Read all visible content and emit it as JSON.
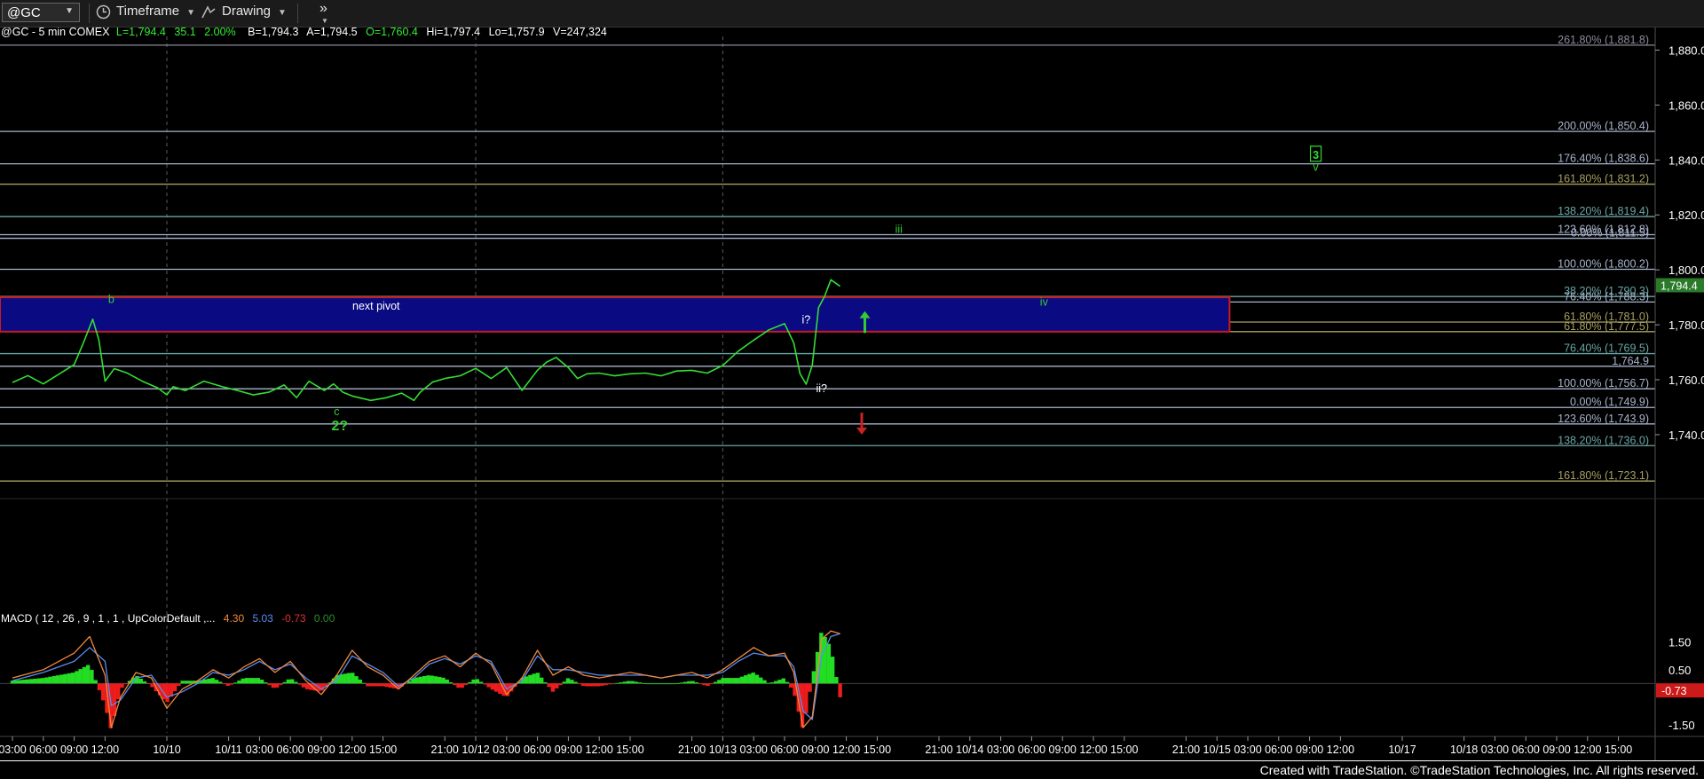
{
  "toolbar": {
    "symbol": "@GC",
    "timeframe_label": "Timeframe",
    "drawing_label": "Drawing",
    "more_label": "»"
  },
  "header": {
    "symbol_info": "@GC - 5 min  COMEX",
    "last": "L=1,794.4",
    "change": "35.1",
    "pct": "2.00%",
    "bid": "B=1,794.3",
    "ask": "A=1,794.5",
    "open": "O=1,760.4",
    "high": "Hi=1,797.4",
    "low": "Lo=1,757.9",
    "volume": "V=247,324"
  },
  "footer": {
    "text": "Created with TradeStation. ©TradeStation Technologies, Inc. All rights reserved."
  },
  "chart_data": {
    "type": "line",
    "ylim": [
      1718,
      1885
    ],
    "y_ticks": [
      1740,
      1760,
      1780,
      1800,
      1820,
      1840,
      1860,
      1880
    ],
    "y_tick_labels": [
      "1,740.0",
      "1,760.0",
      "1,780.0",
      "1,800.0",
      "1,820.0",
      "1,840.0",
      "1,860.0",
      "1,880.0"
    ],
    "current_price": {
      "value": 1794.4,
      "label": "1,794.4"
    },
    "x_labels": [
      "03:00",
      "06:00",
      "09:00",
      "12:00",
      "10/10",
      "10/11",
      "03:00",
      "06:00",
      "09:00",
      "12:00",
      "15:00",
      "21:00",
      "10/12",
      "03:00",
      "06:00",
      "09:00",
      "12:00",
      "15:00",
      "21:00",
      "10/13",
      "03:00",
      "06:00",
      "09:00",
      "12:00",
      "15:00",
      "21:00",
      "10/14",
      "03:00",
      "06:00",
      "09:00",
      "12:00",
      "15:00",
      "21:00",
      "10/15",
      "03:00",
      "06:00",
      "09:00",
      "12:00",
      "10/17",
      "10/18",
      "03:00",
      "06:00",
      "09:00",
      "12:00",
      "15:00"
    ],
    "x_label_index": [
      0,
      1,
      2,
      3,
      5,
      7,
      8,
      9,
      10,
      11,
      12,
      14,
      15,
      16,
      17,
      18,
      19,
      20,
      22,
      23,
      24,
      25,
      26,
      27,
      28,
      30,
      31,
      32,
      33,
      34,
      35,
      36,
      38,
      39,
      40,
      41,
      42,
      43,
      45,
      47,
      48,
      49,
      50,
      51,
      52
    ],
    "price_series": {
      "name": "@GC",
      "color": "#33dd33",
      "x": [
        0,
        0.5,
        1,
        1.5,
        2,
        2.3,
        2.6,
        2.8,
        3.0,
        3.3,
        3.7,
        4.2,
        4.7,
        5.0,
        5.2,
        5.6,
        6.2,
        6.8,
        7.3,
        7.8,
        8.3,
        8.8,
        9.2,
        9.6,
        10.1,
        10.4,
        10.7,
        11.0,
        11.6,
        12.1,
        12.6,
        13.0,
        13.2,
        13.6,
        14.0,
        14.5,
        15.0,
        15.5,
        16.0,
        16.5,
        17.0,
        17.3,
        17.6,
        18.0,
        18.3,
        18.6,
        19.0,
        19.5,
        20.0,
        20.5,
        21.0,
        21.5,
        22.0,
        22.5,
        23.0,
        23.5,
        24.0,
        24.5,
        25.0,
        25.3,
        25.5,
        25.7,
        25.9,
        26.1,
        26.3,
        26.5,
        26.8
      ],
      "y": [
        1759,
        1761,
        1759,
        1762,
        1765,
        1774,
        1782,
        1774,
        1760,
        1764,
        1762,
        1760,
        1757,
        1754,
        1758,
        1756,
        1759,
        1758,
        1756,
        1754,
        1756,
        1758,
        1753,
        1760,
        1756,
        1758,
        1756,
        1754,
        1752,
        1754,
        1755,
        1752,
        1756,
        1759,
        1760,
        1762,
        1764,
        1760,
        1765,
        1756,
        1763,
        1767,
        1768,
        1764,
        1761,
        1762,
        1762,
        1762,
        1762,
        1762,
        1762,
        1763,
        1763,
        1763,
        1765,
        1770,
        1775,
        1778,
        1780,
        1774,
        1762,
        1758,
        1766,
        1786,
        1790,
        1797,
        1794
      ]
    },
    "zone": {
      "label": "next pivot",
      "from": 1777.5,
      "to": 1790,
      "x_end": 38
    },
    "fib_lines": [
      {
        "value": 1881.8,
        "label": "261.80% (1,881.8)",
        "color": "#8a8a9a"
      },
      {
        "value": 1850.4,
        "label": "200.00% (1,850.4)",
        "color": "#a8b4cc"
      },
      {
        "value": 1838.6,
        "label": "176.40% (1,838.6)",
        "color": "#a8b4cc"
      },
      {
        "value": 1831.2,
        "label": "161.80% (1,831.2)",
        "color": "#a8a060"
      },
      {
        "value": 1819.4,
        "label": "138.20% (1,819.4)",
        "color": "#6aa6a6"
      },
      {
        "value": 1812.8,
        "label": "123.60% (1,812.8)",
        "color": "#a8b4cc"
      },
      {
        "value": 1811.5,
        "label": "0.00% (1,811.5)",
        "color": "#a8b4cc"
      },
      {
        "value": 1800.2,
        "label": "100.00% (1,800.2)",
        "color": "#a8b4cc"
      },
      {
        "value": 1790.3,
        "label": "38.20% (1,790.3)",
        "color": "#6aa6a6"
      },
      {
        "value": 1788.3,
        "label": "76.40% (1,788.3)",
        "color": "#a8b4cc"
      },
      {
        "value": 1781.0,
        "label": "61.80% (1,781.0)",
        "color": "#a8a060"
      },
      {
        "value": 1777.5,
        "label": "61.80% (1,777.5)",
        "color": "#a8a060"
      },
      {
        "value": 1769.5,
        "label": "76.40% (1,769.5)",
        "color": "#6aa6a6"
      },
      {
        "value": 1764.9,
        "label": "1,764.9",
        "color": "#a8b4cc"
      },
      {
        "value": 1756.7,
        "label": "100.00% (1,756.7)",
        "color": "#a8b4cc"
      },
      {
        "value": 1749.9,
        "label": "0.00% (1,749.9)",
        "color": "#a8b4cc"
      },
      {
        "value": 1743.9,
        "label": "123.60% (1,743.9)",
        "color": "#a8b4cc"
      },
      {
        "value": 1736.0,
        "label": "138.20% (1,736.0)",
        "color": "#6aa6a6"
      },
      {
        "value": 1723.1,
        "label": "161.80% (1,723.1)",
        "color": "#a8a060"
      }
    ],
    "wave_labels": [
      {
        "text": "b",
        "x": 3.2,
        "y": 1788,
        "color": "#33cc33"
      },
      {
        "text": "c",
        "x": 10.5,
        "y": 1747,
        "color": "#33cc33"
      },
      {
        "text": "2?",
        "x": 10.6,
        "y": 1741.5,
        "color": "#33cc33",
        "bold": true
      },
      {
        "text": "i?",
        "x": 25.7,
        "y": 1780.5,
        "color": "#ffffff"
      },
      {
        "text": "ii?",
        "x": 26.2,
        "y": 1755.5,
        "color": "#ffffff"
      },
      {
        "text": "iii",
        "x": 28.7,
        "y": 1813.5,
        "color": "#33cc33"
      },
      {
        "text": "iv",
        "x": 33.4,
        "y": 1787,
        "color": "#33cc33"
      },
      {
        "text": "v",
        "x": 42.2,
        "y": 1836,
        "color": "#33cc33"
      },
      {
        "text": "3",
        "x": 42.2,
        "y": 1840.5,
        "color": "#33dd33",
        "boxed": true
      }
    ],
    "arrows": [
      {
        "direction": "up",
        "x": 27.6,
        "from": 1777,
        "to": 1785,
        "color": "#33cc33"
      },
      {
        "direction": "down",
        "x": 27.5,
        "from": 1748,
        "to": 1740,
        "color": "#cc2222"
      }
    ],
    "macd": {
      "title": "MACD ( 12 , 26 , 9 , 1 , 1 , UpColorDefault ,...",
      "values": [
        "4.30",
        "5.03",
        "-0.73",
        "0.00"
      ],
      "value_colors": [
        "#f0883c",
        "#5b8cf0",
        "#e03030",
        "#2a8a2a"
      ],
      "ylim": [
        -1.85,
        2.0
      ],
      "y_ticks": [
        1.5,
        0.5,
        -1.5
      ],
      "y_tick_labels": [
        "1.50",
        "0.50",
        "-1.50"
      ],
      "current_label": "-0.73",
      "x": [
        0,
        1,
        2,
        2.5,
        3,
        3.2,
        3.5,
        4,
        4.5,
        5,
        5.5,
        6,
        6.5,
        7,
        7.5,
        8,
        8.5,
        9,
        9.5,
        10,
        10.5,
        11,
        11.5,
        12,
        12.5,
        13,
        13.5,
        14,
        14.5,
        15,
        15.5,
        16,
        16.5,
        17,
        17.5,
        18,
        18.5,
        19,
        19.5,
        20,
        20.5,
        21,
        21.5,
        22,
        22.5,
        23,
        23.5,
        24,
        24.5,
        25,
        25.3,
        25.6,
        25.9,
        26.2,
        26.5,
        26.8
      ],
      "macd_line": [
        0.2,
        0.5,
        1.1,
        1.7,
        0.3,
        -1.6,
        -0.5,
        0.4,
        0.2,
        -0.9,
        -0.2,
        0.1,
        0.5,
        0.2,
        0.6,
        0.9,
        0.4,
        0.8,
        0.1,
        -0.4,
        0.3,
        1.2,
        0.6,
        0.3,
        -0.2,
        0.3,
        0.8,
        1.0,
        0.6,
        1.1,
        0.7,
        -0.4,
        0.2,
        1.2,
        0.3,
        0.6,
        0.3,
        0.2,
        0.3,
        0.4,
        0.3,
        0.2,
        0.3,
        0.4,
        0.2,
        0.5,
        0.9,
        1.3,
        1.0,
        1.1,
        0.4,
        -1.6,
        -1.2,
        1.6,
        1.9,
        1.8
      ],
      "signal_line": [
        0.1,
        0.4,
        0.8,
        1.3,
        0.8,
        -0.8,
        -0.6,
        0.2,
        0.3,
        -0.5,
        -0.3,
        0.0,
        0.4,
        0.3,
        0.5,
        0.8,
        0.5,
        0.7,
        0.2,
        -0.2,
        0.1,
        1.0,
        0.7,
        0.4,
        -0.1,
        0.2,
        0.7,
        0.9,
        0.7,
        1.0,
        0.8,
        -0.2,
        0.1,
        1.0,
        0.5,
        0.5,
        0.4,
        0.3,
        0.3,
        0.3,
        0.3,
        0.2,
        0.3,
        0.3,
        0.3,
        0.4,
        0.8,
        1.1,
        1.0,
        1.0,
        0.6,
        -1.0,
        -1.3,
        1.0,
        1.7,
        1.8
      ],
      "histogram": [
        0.1,
        0.2,
        0.4,
        0.7,
        -0.8,
        -1.7,
        -0.2,
        0.3,
        -0.1,
        -0.7,
        0.1,
        0.1,
        0.2,
        -0.1,
        0.2,
        0.2,
        -0.2,
        0.2,
        -0.2,
        -0.3,
        0.3,
        0.4,
        -0.1,
        -0.1,
        -0.2,
        0.2,
        0.3,
        0.2,
        -0.2,
        0.2,
        -0.2,
        -0.5,
        0.2,
        0.4,
        -0.3,
        0.2,
        -0.1,
        -0.1,
        0.0,
        0.1,
        0.0,
        0.0,
        0.0,
        0.1,
        -0.1,
        0.2,
        0.2,
        0.4,
        0.0,
        0.2,
        -0.3,
        -1.7,
        0.2,
        1.9,
        1.3,
        -0.5
      ]
    }
  }
}
